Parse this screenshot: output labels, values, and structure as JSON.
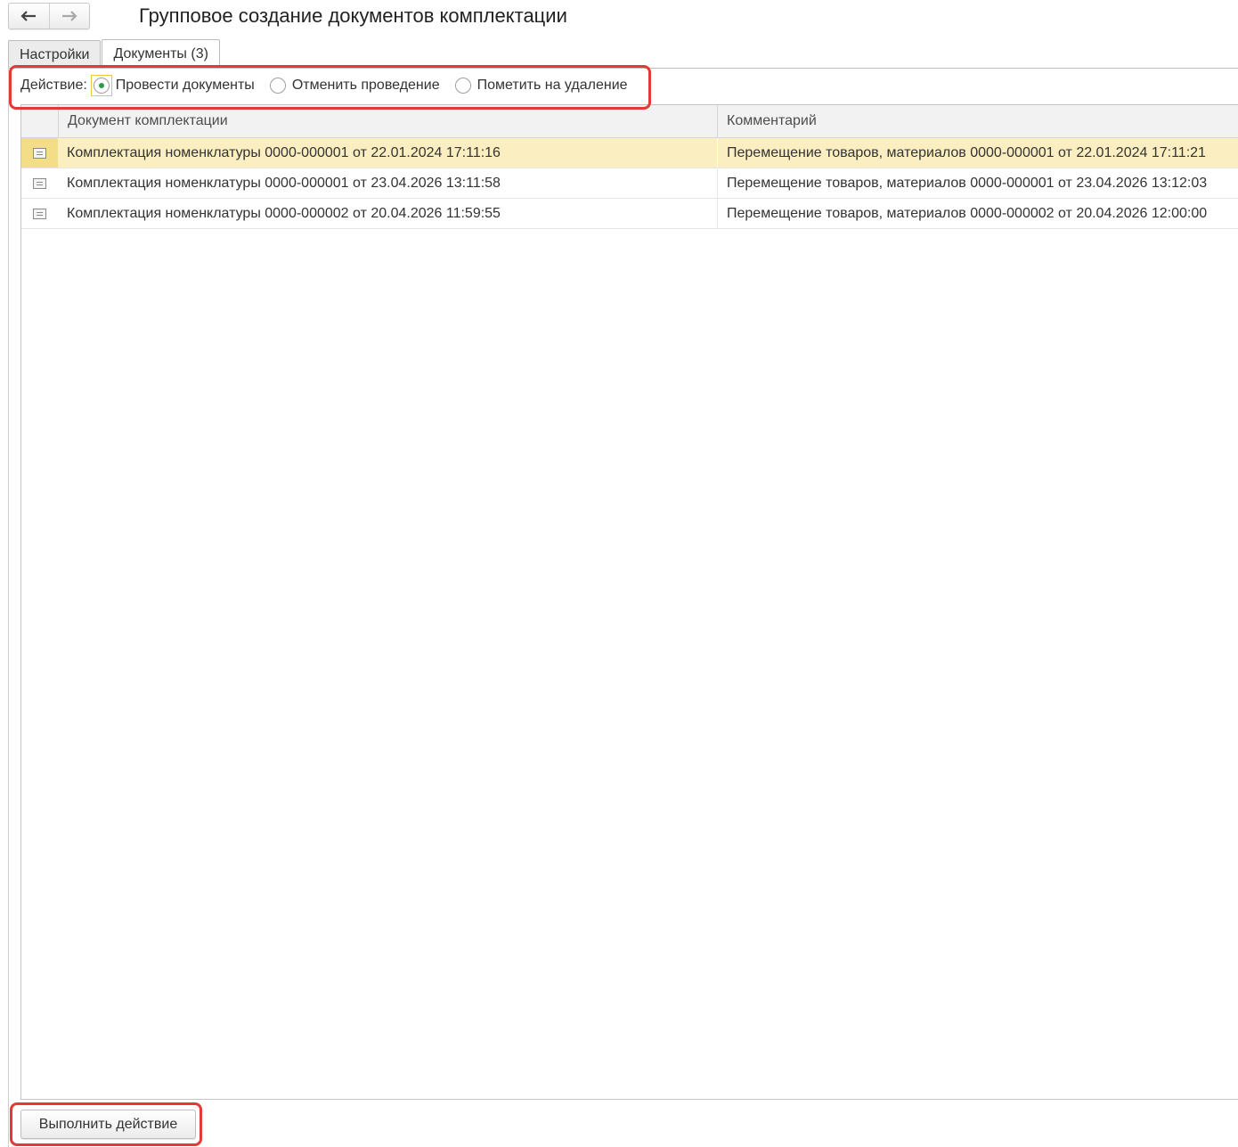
{
  "header": {
    "title": "Групповое создание документов комплектации",
    "back_icon": "arrow-left-icon",
    "forward_icon": "arrow-right-icon"
  },
  "tabs": [
    {
      "label": "Настройки",
      "active": false
    },
    {
      "label": "Документы (3)",
      "active": true
    }
  ],
  "action": {
    "label": "Действие:",
    "options": [
      {
        "label": "Провести документы",
        "selected": true
      },
      {
        "label": "Отменить проведение",
        "selected": false
      },
      {
        "label": "Пометить на удаление",
        "selected": false
      }
    ]
  },
  "table": {
    "columns": [
      "Документ комплектации",
      "Комментарий"
    ],
    "rows": [
      {
        "icon": "document-icon",
        "document": "Комплектация номенклатуры 0000-000001 от 22.01.2024 17:11:16",
        "comment": "Перемещение товаров, материалов 0000-000001 от 22.01.2024 17:11:21",
        "selected": true
      },
      {
        "icon": "document-icon",
        "document": "Комплектация номенклатуры 0000-000001 от 23.04.2026 13:11:58",
        "comment": "Перемещение товаров, материалов 0000-000001 от 23.04.2026 13:12:03",
        "selected": false
      },
      {
        "icon": "document-icon",
        "document": "Комплектация номенклатуры 0000-000002 от 20.04.2026 11:59:55",
        "comment": "Перемещение товаров, материалов 0000-000002 от 20.04.2026 12:00:00",
        "selected": false
      }
    ]
  },
  "footer": {
    "run_button_label": "Выполнить действие"
  },
  "colors": {
    "highlight_border": "#e53935",
    "selected_row": "#fbeec0",
    "radio_selected": "#2e9a4e"
  }
}
